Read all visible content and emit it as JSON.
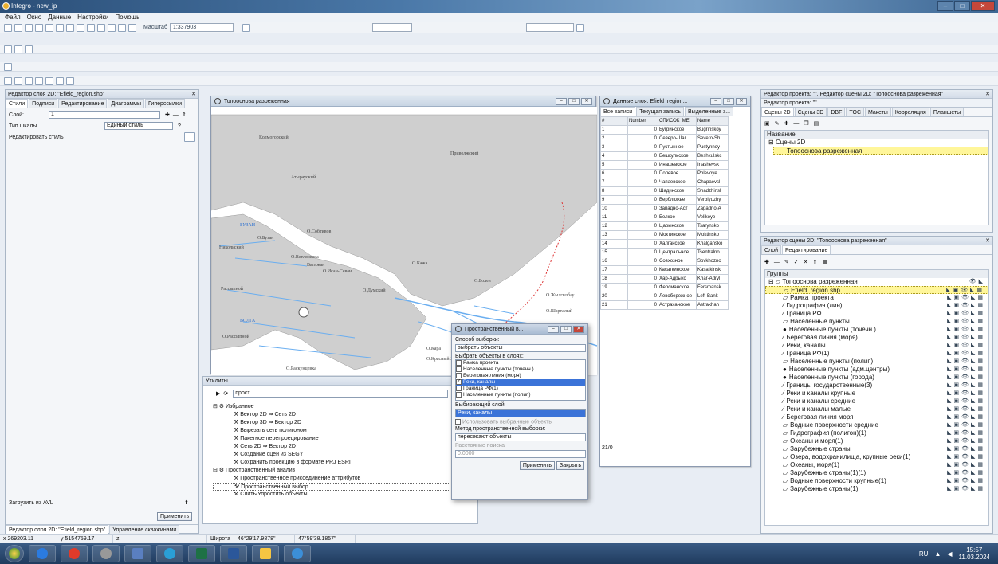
{
  "window": {
    "title": "Integro - new_ip"
  },
  "menu": [
    "Файл",
    "Окно",
    "Данные",
    "Настройки",
    "Помощь"
  ],
  "toolbar": {
    "scale_label": "Масштаб",
    "scale_value": "1:337903"
  },
  "layer_editor": {
    "title": "Редактор слоя 2D: \"Efield_region.shp\"",
    "tabs": [
      "Стили",
      "Подписи",
      "Редактирование",
      "Диаграммы",
      "Гиперссылки"
    ],
    "layer_label": "Слой:",
    "layer_value": "1",
    "scale_type_label": "Тип шкалы",
    "scale_type_value": "Единый стиль",
    "edit_style_label": "Редактировать стиль",
    "load_avl_label": "Загрузить из AVL",
    "apply_button": "Применить",
    "bottom_tabs": [
      "Редактор слоя 2D: \"Efield_region.shp\"",
      "Управление скважинами"
    ]
  },
  "map_window": {
    "title": "Топооснова разреженная",
    "labels": [
      {
        "text": "Колмогорский"
      },
      {
        "text": "Приволжский"
      },
      {
        "text": "Атырауский"
      },
      {
        "text": "БУЗАН"
      },
      {
        "text": "О.Бузан"
      },
      {
        "text": "О.Собтивов"
      },
      {
        "text": "О.Ветлячевка"
      },
      {
        "text": "Рассыпной"
      },
      {
        "text": "Ватижан"
      },
      {
        "text": "Никольский"
      },
      {
        "text": "О.Кажа"
      },
      {
        "text": "О.Болев"
      },
      {
        "text": "ВОЛГА"
      },
      {
        "text": "О.Рассыпной"
      },
      {
        "text": "О.Раскунцевка"
      },
      {
        "text": "О.Исан-Севан"
      },
      {
        "text": "О.Думский"
      },
      {
        "text": "О.Жылгызбау"
      },
      {
        "text": "О.Шарталый"
      },
      {
        "text": "О.Кара"
      },
      {
        "text": "О.Красный Яр"
      }
    ]
  },
  "utilities": {
    "title": "Утилиты",
    "search_value": "прост",
    "favorites_label": "Избранное",
    "favorites": [
      "Вектор 2D ⇒ Сеть 2D",
      "Вектор 3D ⇒ Вектор 2D",
      "Вырезать сеть полигоном",
      "Пакетное перепроецирование",
      "Сеть 2D ⇒ Вектор 2D",
      "Создание сцен из SEGY",
      "Сохранить проекцию в формате PRJ ESRI"
    ],
    "spatial_label": "Пространственный анализ",
    "spatial": [
      "Пространственное присоединение аттрибутов",
      "Пространственный выбор",
      "Слить/Упростить объекты"
    ]
  },
  "data_window": {
    "title": "Данные слоя: Efield_region...",
    "tabs": [
      "Все записи",
      "Текущая запись",
      "Выделенные з..."
    ],
    "columns": [
      "#",
      "Number",
      "СПИСОК_МЕ",
      "Name"
    ],
    "rows": [
      [
        "1",
        "0",
        "Бугринское",
        "Bugrinskoy"
      ],
      [
        "2",
        "0",
        "Северо-Шаг",
        "Severo-Sh"
      ],
      [
        "3",
        "0",
        "Пустынное",
        "Pustynnoy"
      ],
      [
        "4",
        "0",
        "Бешкульское",
        "Beshkulskc"
      ],
      [
        "5",
        "0",
        "Инашевское",
        "Inashevsk"
      ],
      [
        "6",
        "0",
        "Полевое",
        "Polevoye"
      ],
      [
        "7",
        "0",
        "Чапаевское",
        "Chapaevsl"
      ],
      [
        "8",
        "0",
        "Шадинское",
        "Shadzhinsl"
      ],
      [
        "9",
        "0",
        "Верблюжье",
        "Verblyuzhy"
      ],
      [
        "10",
        "0",
        "Западно-Аст",
        "Zapadno-A"
      ],
      [
        "11",
        "0",
        "Белкое",
        "Velikoye"
      ],
      [
        "12",
        "0",
        "Царынское",
        "Tsarynsko"
      ],
      [
        "13",
        "0",
        "Моктинское",
        "Moktinsko"
      ],
      [
        "14",
        "0",
        "Халганское",
        "Khalgansko"
      ],
      [
        "15",
        "0",
        "Центральное",
        "Tsentralno"
      ],
      [
        "16",
        "0",
        "Совхозное",
        "Sovkhozno"
      ],
      [
        "17",
        "0",
        "Касаткинское",
        "Kasatkinsk"
      ],
      [
        "18",
        "0",
        "Хар-Адрыко",
        "Khar-Adryl"
      ],
      [
        "19",
        "0",
        "Ферсманское",
        "Fersmansk"
      ],
      [
        "20",
        "0",
        "Левобережное",
        "Left-Bank"
      ],
      [
        "21",
        "0",
        "Астраханское",
        "Astrakhan"
      ]
    ],
    "count": "21/0"
  },
  "spatial_dialog": {
    "title": "Пространственный в...",
    "method_label": "Способ выборки:",
    "method_value": "выбрать объекты",
    "layers_label": "Выбрать объекты в слоях:",
    "layers": [
      {
        "name": "Рамка проекта",
        "checked": false,
        "selected": false
      },
      {
        "name": "Населенные пункты (точечн.)",
        "checked": false,
        "selected": false
      },
      {
        "name": "Береговая линия (моря)",
        "checked": false,
        "selected": false
      },
      {
        "name": "Реки, каналы",
        "checked": true,
        "selected": true
      },
      {
        "name": "Граница РФ(1)",
        "checked": false,
        "selected": false
      },
      {
        "name": "Населенные пункты (полиг.)",
        "checked": false,
        "selected": false
      }
    ],
    "selecting_layer_label": "Выбирающий слой:",
    "selecting_layer_value": "Реки, каналы",
    "use_selected_label": "Использовать выбранные объекты",
    "spatial_method_label": "Метод пространственной выборки:",
    "spatial_method_value": "пересекают объекты",
    "distance_label": "Расстояние поиска",
    "distance_value": "0.0000",
    "apply_button": "Применить",
    "close_button": "Закрыть"
  },
  "project_editor": {
    "title": "Редактор проекта: \"\", Редактор сцены 2D: \"Топооснова разреженная\"",
    "subtitle": "Редактор проекта: \"\"",
    "tabs": [
      "Сцены 2D",
      "Сцены 3D",
      "DBF",
      "TOC",
      "Макеты",
      "Корреляция",
      "Планшеты"
    ],
    "name_header": "Название",
    "tree": [
      "Сцены 2D",
      "Топооснова разреженная"
    ]
  },
  "scene_editor": {
    "title": "Редактор сцены 2D: \"Топооснова разреженная\"",
    "tabs": [
      "Слой",
      "Редактирование"
    ],
    "groups_header": "Группы",
    "root": "Топооснова разреженная",
    "layers": [
      {
        "name": "Efield_region.shp",
        "icon": "▱"
      },
      {
        "name": "Рамка проекта",
        "icon": "▱"
      },
      {
        "name": "Гидрография (лин)",
        "icon": "∕"
      },
      {
        "name": "Граница РФ",
        "icon": "∕"
      },
      {
        "name": "Населенные пункты",
        "icon": "▱"
      },
      {
        "name": "Населенные пункты (точечн.)",
        "icon": "●"
      },
      {
        "name": "Береговая линия (моря)",
        "icon": "∕"
      },
      {
        "name": "Реки, каналы",
        "icon": "∕"
      },
      {
        "name": "Граница РФ(1)",
        "icon": "∕"
      },
      {
        "name": "Населенные пункты (полиг.)",
        "icon": "▱"
      },
      {
        "name": "Населенные пункты (адм.центры)",
        "icon": "●"
      },
      {
        "name": "Населенные пункты (города)",
        "icon": "●"
      },
      {
        "name": "Границы государственные(3)",
        "icon": "∕"
      },
      {
        "name": "Реки и каналы крупные",
        "icon": "∕"
      },
      {
        "name": "Реки и каналы средние",
        "icon": "∕"
      },
      {
        "name": "Реки и каналы малые",
        "icon": "∕"
      },
      {
        "name": "Береговая линия моря",
        "icon": "∕"
      },
      {
        "name": "Водные поверхности средние",
        "icon": "▱"
      },
      {
        "name": "Гидрография (полигон)(1)",
        "icon": "▱"
      },
      {
        "name": "Океаны и моря(1)",
        "icon": "▱"
      },
      {
        "name": "Зарубежные страны",
        "icon": "▱"
      },
      {
        "name": "Озера, водохранилища, крупные реки(1)",
        "icon": "▱"
      },
      {
        "name": "Океаны, моря(1)",
        "icon": "▱"
      },
      {
        "name": "Зарубежные страны(1)(1)",
        "icon": "▱"
      },
      {
        "name": "Водные поверхности крупные(1)",
        "icon": "▱"
      },
      {
        "name": "Зарубежные страны(1)",
        "icon": "▱"
      }
    ]
  },
  "status": {
    "x": "x 269203.11",
    "y": "y 5154759.17",
    "z": "z",
    "lat_label": "Широта",
    "lat": "46°29'17.9878\"",
    "lon": "47°59'38.1857\""
  },
  "taskbar": {
    "lang": "RU",
    "time": "15:57",
    "date": "11.03.2024"
  },
  "colors": {
    "accent": "#3b73d8",
    "water": "#6aaef0",
    "land": "#cfcfcf",
    "selection": "#fff69a"
  }
}
